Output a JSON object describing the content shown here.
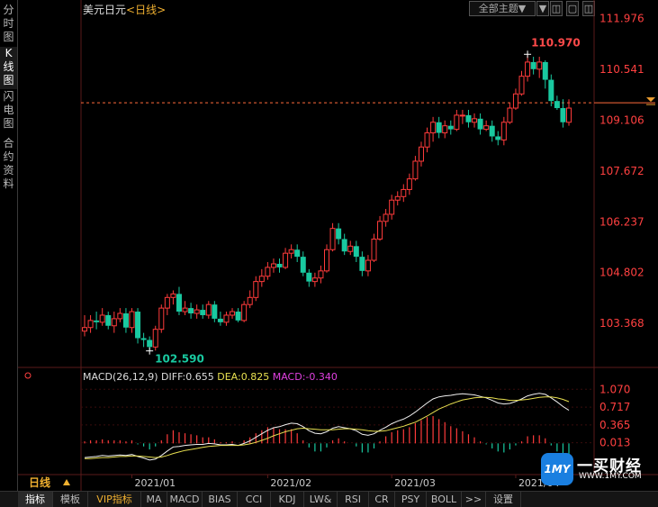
{
  "side_tabs": [
    {
      "label": "分时图"
    },
    {
      "label": "K线图"
    },
    {
      "label": "闪电图"
    },
    {
      "label": "合约资料"
    }
  ],
  "header": {
    "instrument": "美元日元",
    "timeframe": "<日线>"
  },
  "top_buttons": {
    "filter": "全部主题▼",
    "b1": "▼",
    "b2": "◫",
    "b3": "▢",
    "b4": "◫"
  },
  "period_label": "日线",
  "macd_legend": {
    "name": "MACD(26,12,9)",
    "diff": "DIFF:0.655",
    "dea": "DEA:0.825",
    "macd": "MACD:-0.340"
  },
  "bottom_tabs": [
    "指标",
    "模板",
    "VIP指标",
    "MA",
    "MACD",
    "BIAS",
    "CCI",
    "KDJ",
    "LW&",
    "RSI",
    "CR",
    "PSY",
    "BOLL",
    ">>",
    "设置"
  ],
  "watermark": {
    "mark": "1MY",
    "name": "一买财经",
    "url": "WWW.1MY.COM"
  },
  "colors": {
    "up": "#ff3b3b",
    "down": "#19c9a0",
    "dif": "#f0f0f0",
    "dea": "#e8e050",
    "axis": "#ff4040",
    "grid": "#3a0c0c"
  },
  "chart_data": {
    "type": "candlestick",
    "y_ticks": [
      "111.976",
      "110.541",
      "109.106",
      "107.672",
      "106.237",
      "104.802",
      "103.368"
    ],
    "ylim": [
      102.2,
      112.3
    ],
    "current_price_line": 109.6,
    "high_label": "110.970",
    "low_label": "102.590",
    "x_ticks": [
      "2021/01",
      "2021/02",
      "2021/03",
      "2021/04"
    ],
    "candles": [
      [
        103.15,
        103.25,
        103.6,
        103.0
      ],
      [
        103.25,
        103.45,
        103.6,
        103.1
      ],
      [
        103.45,
        103.4,
        103.7,
        103.2
      ],
      [
        103.4,
        103.6,
        103.8,
        103.3
      ],
      [
        103.6,
        103.3,
        103.7,
        103.2
      ],
      [
        103.3,
        103.5,
        103.7,
        103.1
      ],
      [
        103.5,
        103.65,
        103.8,
        103.4
      ],
      [
        103.65,
        103.25,
        103.8,
        103.1
      ],
      [
        103.25,
        103.7,
        103.8,
        103.1
      ],
      [
        103.7,
        102.95,
        103.8,
        102.8
      ],
      [
        102.95,
        102.9,
        103.1,
        102.7
      ],
      [
        102.9,
        102.7,
        103.0,
        102.59
      ],
      [
        102.7,
        103.2,
        103.3,
        102.6
      ],
      [
        103.2,
        103.8,
        103.9,
        103.1
      ],
      [
        103.8,
        104.1,
        104.2,
        103.6
      ],
      [
        104.1,
        104.2,
        104.3,
        103.9
      ],
      [
        104.2,
        103.7,
        104.4,
        103.6
      ],
      [
        103.7,
        103.8,
        104.0,
        103.6
      ],
      [
        103.8,
        103.65,
        103.95,
        103.5
      ],
      [
        103.65,
        103.75,
        103.9,
        103.5
      ],
      [
        103.75,
        103.6,
        103.9,
        103.5
      ],
      [
        103.6,
        103.9,
        104.0,
        103.5
      ],
      [
        103.9,
        103.5,
        104.0,
        103.4
      ],
      [
        103.5,
        103.4,
        103.7,
        103.3
      ],
      [
        103.4,
        103.6,
        103.7,
        103.3
      ],
      [
        103.6,
        103.7,
        103.8,
        103.5
      ],
      [
        103.7,
        103.45,
        103.8,
        103.4
      ],
      [
        103.45,
        103.9,
        104.0,
        103.4
      ],
      [
        103.9,
        104.1,
        104.3,
        103.8
      ],
      [
        104.1,
        104.55,
        104.7,
        104.0
      ],
      [
        104.55,
        104.7,
        104.9,
        104.4
      ],
      [
        104.7,
        104.95,
        105.1,
        104.6
      ],
      [
        104.95,
        105.05,
        105.2,
        104.8
      ],
      [
        105.05,
        104.95,
        105.2,
        104.8
      ],
      [
        104.95,
        105.35,
        105.5,
        104.9
      ],
      [
        105.35,
        105.45,
        105.6,
        105.2
      ],
      [
        105.45,
        105.25,
        105.6,
        105.1
      ],
      [
        105.25,
        104.8,
        105.4,
        104.7
      ],
      [
        104.8,
        104.55,
        104.9,
        104.4
      ],
      [
        104.55,
        104.65,
        104.8,
        104.4
      ],
      [
        104.65,
        104.85,
        105.0,
        104.5
      ],
      [
        104.85,
        105.45,
        105.6,
        104.8
      ],
      [
        105.45,
        106.05,
        106.2,
        105.4
      ],
      [
        106.05,
        105.75,
        106.2,
        105.6
      ],
      [
        105.75,
        105.4,
        105.9,
        105.3
      ],
      [
        105.4,
        105.55,
        105.7,
        105.3
      ],
      [
        105.55,
        105.25,
        105.7,
        105.1
      ],
      [
        105.25,
        104.85,
        105.4,
        104.7
      ],
      [
        104.85,
        105.15,
        105.3,
        104.7
      ],
      [
        105.15,
        105.75,
        105.9,
        105.1
      ],
      [
        105.75,
        106.25,
        106.4,
        105.7
      ],
      [
        106.25,
        106.45,
        106.6,
        106.1
      ],
      [
        106.45,
        106.85,
        107.0,
        106.3
      ],
      [
        106.85,
        106.95,
        107.1,
        106.7
      ],
      [
        106.95,
        107.15,
        107.3,
        106.8
      ],
      [
        107.15,
        107.45,
        107.6,
        107.0
      ],
      [
        107.45,
        107.95,
        108.1,
        107.4
      ],
      [
        107.95,
        108.35,
        108.5,
        107.8
      ],
      [
        108.35,
        108.75,
        108.9,
        108.2
      ],
      [
        108.75,
        109.05,
        109.2,
        108.5
      ],
      [
        109.05,
        108.75,
        109.2,
        108.6
      ],
      [
        108.75,
        108.95,
        109.1,
        108.6
      ],
      [
        108.95,
        108.85,
        109.1,
        108.7
      ],
      [
        108.85,
        109.25,
        109.4,
        108.8
      ],
      [
        109.25,
        109.25,
        109.4,
        109.0
      ],
      [
        109.25,
        109.05,
        109.4,
        108.9
      ],
      [
        109.05,
        109.15,
        109.3,
        108.9
      ],
      [
        109.15,
        108.85,
        109.3,
        108.7
      ],
      [
        108.85,
        108.95,
        109.1,
        108.8
      ],
      [
        108.95,
        108.65,
        109.1,
        108.5
      ],
      [
        108.65,
        108.55,
        108.8,
        108.4
      ],
      [
        108.55,
        109.05,
        109.2,
        108.4
      ],
      [
        109.05,
        109.45,
        109.6,
        109.0
      ],
      [
        109.45,
        109.85,
        110.0,
        109.4
      ],
      [
        109.85,
        110.35,
        110.5,
        109.8
      ],
      [
        110.35,
        110.75,
        110.97,
        110.2
      ],
      [
        110.75,
        110.55,
        110.9,
        110.4
      ],
      [
        110.55,
        110.75,
        110.9,
        110.3
      ],
      [
        110.75,
        110.25,
        110.8,
        110.0
      ],
      [
        110.25,
        109.65,
        110.4,
        109.5
      ],
      [
        109.65,
        109.45,
        109.8,
        109.4
      ],
      [
        109.45,
        109.05,
        109.7,
        108.9
      ],
      [
        109.05,
        109.45,
        109.7,
        108.95
      ]
    ],
    "macd": {
      "y_ticks": [
        "1.070",
        "0.717",
        "0.365",
        "0.013"
      ],
      "ylim": [
        -0.35,
        1.2
      ],
      "dif": [
        -0.28,
        -0.27,
        -0.26,
        -0.24,
        -0.25,
        -0.24,
        -0.23,
        -0.24,
        -0.22,
        -0.26,
        -0.29,
        -0.33,
        -0.31,
        -0.24,
        -0.15,
        -0.07,
        -0.06,
        -0.04,
        -0.03,
        -0.02,
        -0.02,
        0.0,
        -0.01,
        -0.03,
        -0.03,
        -0.02,
        -0.04,
        0.0,
        0.05,
        0.12,
        0.19,
        0.26,
        0.31,
        0.33,
        0.37,
        0.4,
        0.39,
        0.33,
        0.25,
        0.2,
        0.19,
        0.23,
        0.3,
        0.33,
        0.31,
        0.29,
        0.25,
        0.18,
        0.16,
        0.19,
        0.26,
        0.32,
        0.39,
        0.44,
        0.48,
        0.54,
        0.62,
        0.71,
        0.8,
        0.88,
        0.92,
        0.94,
        0.95,
        0.97,
        0.98,
        0.97,
        0.96,
        0.93,
        0.9,
        0.85,
        0.8,
        0.78,
        0.79,
        0.83,
        0.88,
        0.94,
        0.97,
        0.99,
        0.97,
        0.9,
        0.82,
        0.73,
        0.655
      ],
      "dea": [
        -0.3,
        -0.3,
        -0.29,
        -0.28,
        -0.28,
        -0.27,
        -0.26,
        -0.26,
        -0.25,
        -0.25,
        -0.26,
        -0.27,
        -0.28,
        -0.27,
        -0.24,
        -0.2,
        -0.17,
        -0.14,
        -0.12,
        -0.1,
        -0.08,
        -0.06,
        -0.05,
        -0.04,
        -0.04,
        -0.04,
        -0.04,
        -0.03,
        -0.01,
        0.02,
        0.06,
        0.1,
        0.15,
        0.19,
        0.23,
        0.26,
        0.29,
        0.3,
        0.29,
        0.28,
        0.27,
        0.27,
        0.27,
        0.28,
        0.29,
        0.29,
        0.28,
        0.27,
        0.25,
        0.24,
        0.24,
        0.25,
        0.28,
        0.31,
        0.34,
        0.38,
        0.42,
        0.48,
        0.54,
        0.61,
        0.68,
        0.73,
        0.78,
        0.82,
        0.86,
        0.88,
        0.9,
        0.91,
        0.91,
        0.9,
        0.88,
        0.87,
        0.85,
        0.85,
        0.86,
        0.87,
        0.89,
        0.91,
        0.92,
        0.92,
        0.9,
        0.87,
        0.825
      ]
    }
  }
}
